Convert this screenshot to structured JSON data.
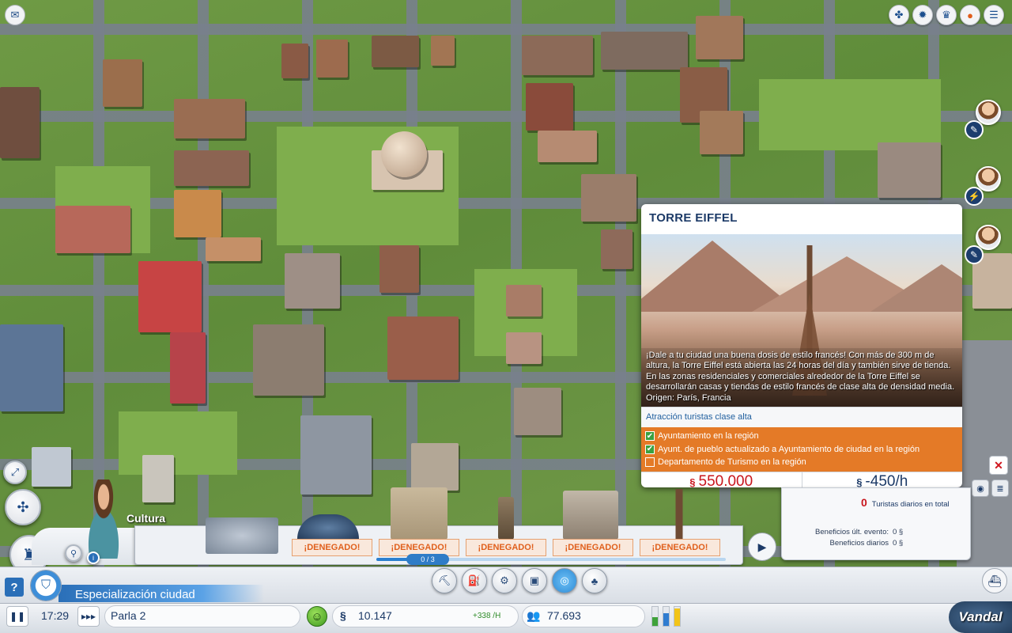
{
  "top_icons": [
    "awards-icon",
    "region-icon",
    "trophy-icon",
    "notifications-icon",
    "menu-icon"
  ],
  "popup": {
    "title": "TORRE EIFFEL",
    "description": "¡Dale a tu ciudad una buena dosis de estilo francés! Con más de 300 m de altura, la Torre Eiffel está abierta las 24 horas del día y también sirve de tienda.",
    "description2": "En las zonas residenciales y comerciales alrededor de la Torre Eiffel se desarrollarán casas y tiendas de estilo francés de clase alta de densidad media.",
    "origin": "Origen: París, Francia",
    "attraction": "Atracción turistas clase alta",
    "requirements": [
      {
        "label": "Ayuntamiento en la región",
        "met": true
      },
      {
        "label": "Ayunt. de pueblo actualizado a Ayuntamiento de ciudad en la región",
        "met": true
      },
      {
        "label": "Departamento de Turismo en la región",
        "met": false
      }
    ],
    "cost": "550.000",
    "upkeep": "-450/h"
  },
  "stats_panel": {
    "tourists_value": "0",
    "tourists_label": "Turistas diarios en total",
    "event_label": "Beneficios últ. evento:",
    "event_value": "0 §",
    "daily_label": "Beneficios diarios",
    "daily_value": "0 §"
  },
  "category": {
    "label": "Cultura",
    "denied_labels": [
      "¡DENEGADO!",
      "¡DENEGADO!",
      "¡DENEGADO!",
      "¡DENEGADO!",
      "¡DENEGADO!"
    ],
    "pager": "0 / 3",
    "progress": 0.1
  },
  "specialization": {
    "label": "Especialización ciudad",
    "help": "?"
  },
  "status_bar": {
    "time": "17:29",
    "city_name": "Parla 2",
    "simoleons": "10.147",
    "income": "+338 /H",
    "population": "77.693",
    "rci": [
      {
        "color": "#3fa23a",
        "level": 0.45
      },
      {
        "color": "#2f7cd0",
        "level": 0.65
      },
      {
        "color": "#f2c418",
        "level": 0.9
      }
    ]
  },
  "watermark": "Vandal",
  "colors": {
    "accent_blue": "#2a6fb8",
    "denied_orange": "#e0601d",
    "requirements_bg": "#e47a27",
    "cost_red": "#c8161d"
  }
}
